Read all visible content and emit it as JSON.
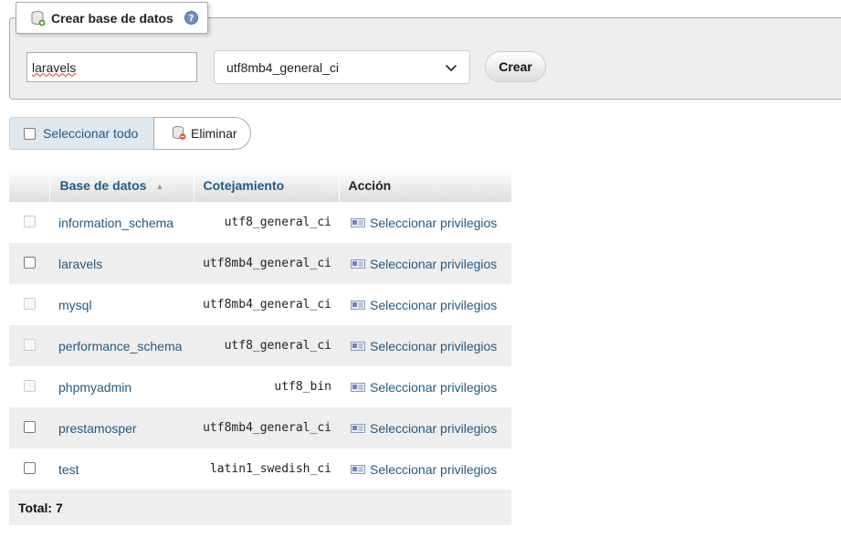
{
  "create": {
    "legend": "Crear base de datos",
    "name_value": "laravels",
    "collation_selected": "utf8mb4_general_ci",
    "create_label": "Crear"
  },
  "toolbar": {
    "select_all_label": "Seleccionar todo",
    "delete_label": "Eliminar"
  },
  "table": {
    "headers": [
      "Base de datos",
      "Cotejamiento",
      "Acción"
    ],
    "rows": [
      {
        "name": "information_schema",
        "collation": "utf8_general_ci",
        "action": "Seleccionar privilegios",
        "checkbox_enabled": false
      },
      {
        "name": "laravels",
        "collation": "utf8mb4_general_ci",
        "action": "Seleccionar privilegios",
        "checkbox_enabled": true
      },
      {
        "name": "mysql",
        "collation": "utf8mb4_general_ci",
        "action": "Seleccionar privilegios",
        "checkbox_enabled": false
      },
      {
        "name": "performance_schema",
        "collation": "utf8_general_ci",
        "action": "Seleccionar privilegios",
        "checkbox_enabled": false
      },
      {
        "name": "phpmyadmin",
        "collation": "utf8_bin",
        "action": "Seleccionar privilegios",
        "checkbox_enabled": false
      },
      {
        "name": "prestamosper",
        "collation": "utf8mb4_general_ci",
        "action": "Seleccionar privilegios",
        "checkbox_enabled": true
      },
      {
        "name": "test",
        "collation": "latin1_swedish_ci",
        "action": "Seleccionar privilegios",
        "checkbox_enabled": true
      }
    ],
    "total_label": "Total: 7"
  },
  "colors": {
    "link": "#235a81",
    "panel_bg": "#eeeeee",
    "row_alt": "#eeeeee"
  },
  "icons": {
    "legend": "database-add-icon",
    "help": "help-icon",
    "dropdown": "chevron-down-icon",
    "delete": "delete-db-icon",
    "privileges": "privileges-icon",
    "sort": "sort-ascending-icon"
  }
}
